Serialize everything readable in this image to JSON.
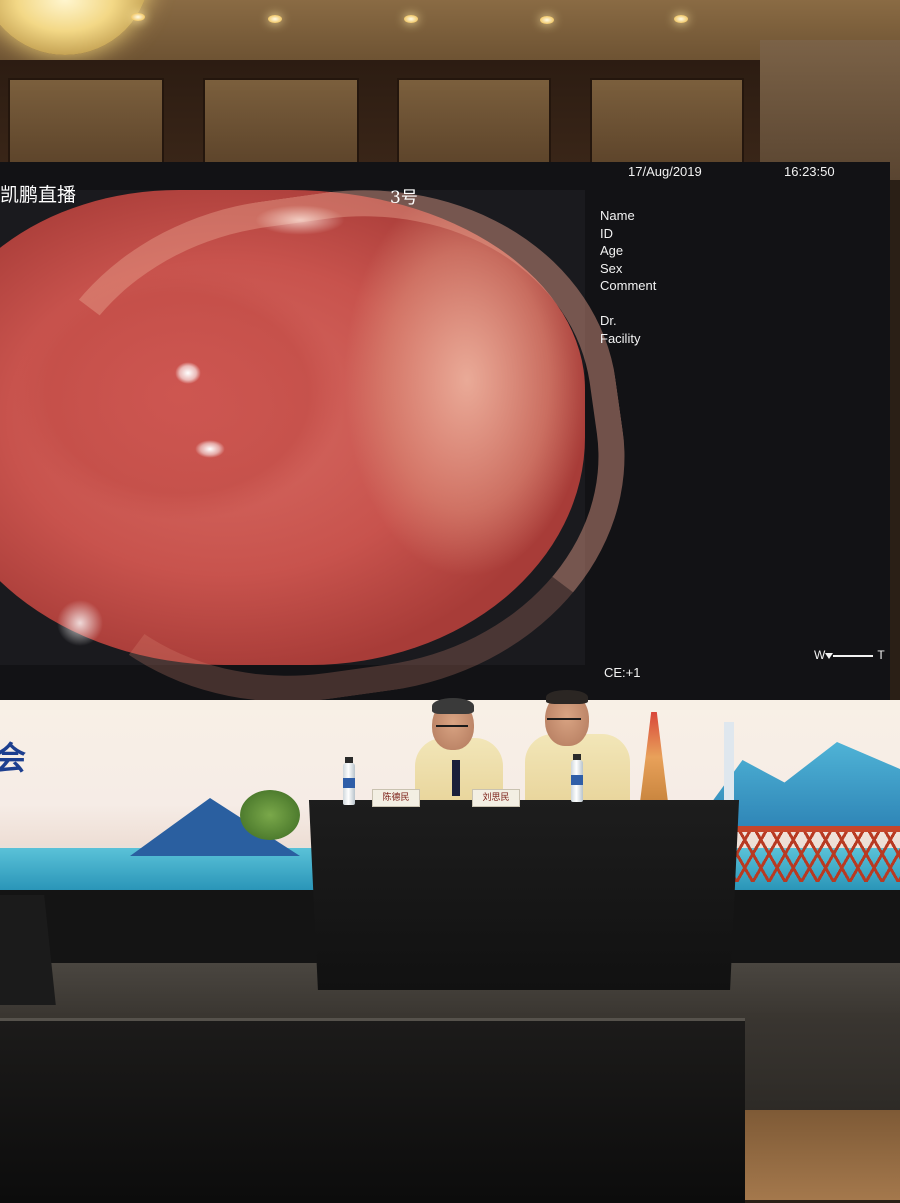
{
  "screen": {
    "channel_title": "凯鹏直播",
    "room_label": "3号",
    "date": "17/Aug/2019",
    "time": "16:23:50",
    "patient_fields": [
      "Name",
      "ID",
      "Age",
      "Sex",
      "Comment"
    ],
    "staff_fields": [
      "Dr.",
      "Facility"
    ],
    "contrast_enhancement": "CE:+1",
    "zoom_scale": {
      "left": "W",
      "right": "T"
    }
  },
  "banner": {
    "visible_character": "会"
  },
  "panel": {
    "nameplates": [
      "陈德民",
      "刘思民"
    ]
  },
  "colors": {
    "mucosa": "#c8534d",
    "screen_background": "#121215",
    "osd_text": "#f2f2f2",
    "banner_accent": "#1d3f8f",
    "bridge": "#c6452a"
  }
}
